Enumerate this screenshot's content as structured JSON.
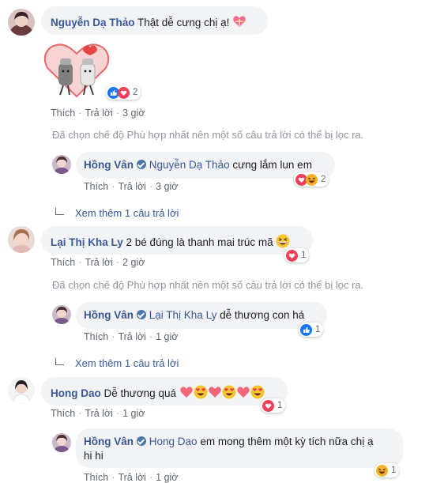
{
  "colors": {
    "link": "#385898",
    "bubble": "#f2f3f5",
    "meta": "#606770",
    "like": "#1877f2",
    "love": "#f33e58",
    "haha": "#f7b125"
  },
  "comments": [
    {
      "author": "Nguyễn Dạ Thảo",
      "text": "Thật dễ cưng chị ạ!",
      "emoji": "heart-gift-icon",
      "sticker": "salt-pepper-love-sticker",
      "reactions": {
        "icons": [
          "like-icon",
          "love-icon"
        ],
        "count": "2"
      },
      "actions": {
        "like": "Thích",
        "reply": "Trả lời",
        "time": "3 giờ"
      },
      "filter_note": "Đã chọn chế độ Phù hợp nhất nên một số câu trả lời có thể bị lọc ra.",
      "reply": {
        "author": "Hồng Vân",
        "mention": "Nguyễn Dạ Thảo",
        "text": "cưng lắm lun em",
        "reactions": {
          "icons": [
            "love-icon",
            "haha-icon"
          ],
          "count": "2"
        },
        "actions": {
          "like": "Thích",
          "reply": "Trả lời",
          "time": "3 giờ"
        }
      },
      "more_replies": "Xem thêm 1 câu trả lời"
    },
    {
      "author": "Lại Thị Kha Ly",
      "text": "2 bé đúng là thanh mai trúc mã",
      "emoji": "grinning-squint-icon",
      "reactions": {
        "icons": [
          "love-icon"
        ],
        "count": "1"
      },
      "actions": {
        "like": "Thích",
        "reply": "Trả lời",
        "time": "2 giờ"
      },
      "filter_note": "Đã chọn chế độ Phù hợp nhất nên một số câu trả lời có thể bị lọc ra.",
      "reply": {
        "author": "Hồng Vân",
        "mention": "Lại Thị Kha Ly",
        "text": "dễ thương con há",
        "reactions": {
          "icons": [
            "like-icon"
          ],
          "count": "1"
        },
        "actions": {
          "like": "Thích",
          "reply": "Trả lời",
          "time": "1 giờ"
        }
      },
      "more_replies": "Xem thêm 1 câu trả lời"
    },
    {
      "author": "Hong Dao",
      "text": "Dễ thương quá",
      "emojis": [
        "heart-icon",
        "heart-eyes-icon",
        "heart-icon",
        "heart-eyes-icon",
        "heart-icon",
        "heart-eyes-icon"
      ],
      "reactions": {
        "icons": [
          "love-icon"
        ],
        "count": "1"
      },
      "actions": {
        "like": "Thích",
        "reply": "Trả lời",
        "time": "1 giờ"
      },
      "reply": {
        "author": "Hồng Vân",
        "mention": "Hong Dao",
        "text": "em mong thêm một kỳ tích nữa chị ạ",
        "text2": "hi hi",
        "reactions": {
          "icons": [
            "haha-icon"
          ],
          "count": "1"
        },
        "actions": {
          "like": "Thích",
          "reply": "Trả lời",
          "time": "1 giờ"
        }
      }
    }
  ]
}
